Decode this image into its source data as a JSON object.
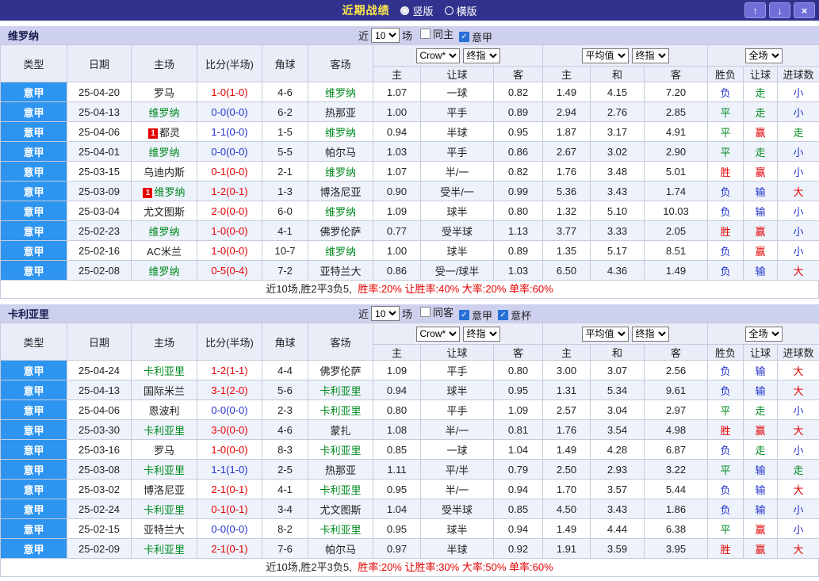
{
  "title_bar": {
    "title": "近期战绩",
    "radios": [
      {
        "label": "竖版",
        "selected": true
      },
      {
        "label": "横版",
        "selected": false
      }
    ],
    "up_button": "↑",
    "down_button": "↓",
    "close_button": "×"
  },
  "filter_labels": {
    "near": "近",
    "games": "场"
  },
  "table_header": {
    "static_cols": [
      "类型",
      "日期",
      "主场",
      "比分(半场)",
      "角球",
      "客场"
    ],
    "group1": {
      "selects": [
        "Crow*",
        "终指"
      ],
      "subcols": [
        "主",
        "让球",
        "客"
      ]
    },
    "group2": {
      "selects": [
        "平均值",
        "终指"
      ],
      "subcols": [
        "主",
        "和",
        "客"
      ]
    },
    "group3": {
      "selects": [
        "全场"
      ],
      "subcols": [
        "胜负",
        "让球",
        "进球数"
      ]
    }
  },
  "result_colors": {
    "胜": "red",
    "平": "green",
    "负": "blue",
    "赢": "red",
    "输": "blue",
    "走": "green",
    "大": "red",
    "小": "blue"
  },
  "sections": [
    {
      "team": "维罗纳",
      "filter": {
        "count": "10",
        "checkboxes": [
          {
            "label": "同主",
            "checked": false
          },
          {
            "label": "意甲",
            "checked": true
          }
        ]
      },
      "rows": [
        {
          "league": "意甲",
          "date": "25-04-20",
          "home": "罗马",
          "home_mark": "",
          "home_focus": false,
          "score": "1-0(1-0)",
          "score_color": "red",
          "corner": "4-6",
          "away": "维罗纳",
          "away_mark": "",
          "away_focus": true,
          "ah": [
            "1.07",
            "一球",
            "0.82"
          ],
          "eu": [
            "1.49",
            "4.15",
            "7.20"
          ],
          "res": [
            "负",
            "走",
            "小"
          ]
        },
        {
          "league": "意甲",
          "date": "25-04-13",
          "home": "维罗纳",
          "home_mark": "",
          "home_focus": true,
          "score": "0-0(0-0)",
          "score_color": "blue",
          "corner": "6-2",
          "away": "热那亚",
          "away_mark": "",
          "away_focus": false,
          "ah": [
            "1.00",
            "平手",
            "0.89"
          ],
          "eu": [
            "2.94",
            "2.76",
            "2.85"
          ],
          "res": [
            "平",
            "走",
            "小"
          ]
        },
        {
          "league": "意甲",
          "date": "25-04-06",
          "home": "都灵",
          "home_mark": "1",
          "home_focus": false,
          "score": "1-1(0-0)",
          "score_color": "blue",
          "corner": "1-5",
          "away": "维罗纳",
          "away_mark": "",
          "away_focus": true,
          "ah": [
            "0.94",
            "半球",
            "0.95"
          ],
          "eu": [
            "1.87",
            "3.17",
            "4.91"
          ],
          "res": [
            "平",
            "赢",
            "走"
          ]
        },
        {
          "league": "意甲",
          "date": "25-04-01",
          "home": "维罗纳",
          "home_mark": "",
          "home_focus": true,
          "score": "0-0(0-0)",
          "score_color": "blue",
          "corner": "5-5",
          "away": "帕尔马",
          "away_mark": "",
          "away_focus": false,
          "ah": [
            "1.03",
            "平手",
            "0.86"
          ],
          "eu": [
            "2.67",
            "3.02",
            "2.90"
          ],
          "res": [
            "平",
            "走",
            "小"
          ]
        },
        {
          "league": "意甲",
          "date": "25-03-15",
          "home": "乌迪内斯",
          "home_mark": "",
          "home_focus": false,
          "score": "0-1(0-0)",
          "score_color": "red",
          "corner": "2-1",
          "away": "维罗纳",
          "away_mark": "",
          "away_focus": true,
          "ah": [
            "1.07",
            "半/一",
            "0.82"
          ],
          "eu": [
            "1.76",
            "3.48",
            "5.01"
          ],
          "res": [
            "胜",
            "赢",
            "小"
          ]
        },
        {
          "league": "意甲",
          "date": "25-03-09",
          "home": "维罗纳",
          "home_mark": "1",
          "home_focus": true,
          "score": "1-2(0-1)",
          "score_color": "red",
          "corner": "1-3",
          "away": "博洛尼亚",
          "away_mark": "",
          "away_focus": false,
          "ah": [
            "0.90",
            "受半/一",
            "0.99"
          ],
          "eu": [
            "5.36",
            "3.43",
            "1.74"
          ],
          "res": [
            "负",
            "输",
            "大"
          ]
        },
        {
          "league": "意甲",
          "date": "25-03-04",
          "home": "尤文图斯",
          "home_mark": "",
          "home_focus": false,
          "score": "2-0(0-0)",
          "score_color": "red",
          "corner": "6-0",
          "away": "维罗纳",
          "away_mark": "",
          "away_focus": true,
          "ah": [
            "1.09",
            "球半",
            "0.80"
          ],
          "eu": [
            "1.32",
            "5.10",
            "10.03"
          ],
          "res": [
            "负",
            "输",
            "小"
          ]
        },
        {
          "league": "意甲",
          "date": "25-02-23",
          "home": "维罗纳",
          "home_mark": "",
          "home_focus": true,
          "score": "1-0(0-0)",
          "score_color": "red",
          "corner": "4-1",
          "away": "佛罗伦萨",
          "away_mark": "",
          "away_focus": false,
          "ah": [
            "0.77",
            "受半球",
            "1.13"
          ],
          "eu": [
            "3.77",
            "3.33",
            "2.05"
          ],
          "res": [
            "胜",
            "赢",
            "小"
          ]
        },
        {
          "league": "意甲",
          "date": "25-02-16",
          "home": "AC米兰",
          "home_mark": "",
          "home_focus": false,
          "score": "1-0(0-0)",
          "score_color": "red",
          "corner": "10-7",
          "away": "维罗纳",
          "away_mark": "",
          "away_focus": true,
          "ah": [
            "1.00",
            "球半",
            "0.89"
          ],
          "eu": [
            "1.35",
            "5.17",
            "8.51"
          ],
          "res": [
            "负",
            "赢",
            "小"
          ]
        },
        {
          "league": "意甲",
          "date": "25-02-08",
          "home": "维罗纳",
          "home_mark": "",
          "home_focus": true,
          "score": "0-5(0-4)",
          "score_color": "red",
          "corner": "7-2",
          "away": "亚特兰大",
          "away_mark": "",
          "away_focus": false,
          "ah": [
            "0.86",
            "受一/球半",
            "1.03"
          ],
          "eu": [
            "6.50",
            "4.36",
            "1.49"
          ],
          "res": [
            "负",
            "输",
            "大"
          ]
        }
      ],
      "summary": {
        "prefix": "近10场,胜2平3负5,",
        "stats": "胜率:20% 让胜率:40% 大率:20% 单率:60%"
      }
    },
    {
      "team": "卡利亚里",
      "filter": {
        "count": "10",
        "checkboxes": [
          {
            "label": "同客",
            "checked": false
          },
          {
            "label": "意甲",
            "checked": true
          },
          {
            "label": "意杯",
            "checked": true
          }
        ]
      },
      "rows": [
        {
          "league": "意甲",
          "date": "25-04-24",
          "home": "卡利亚里",
          "home_mark": "",
          "home_focus": true,
          "score": "1-2(1-1)",
          "score_color": "red",
          "corner": "4-4",
          "away": "佛罗伦萨",
          "away_mark": "",
          "away_focus": false,
          "ah": [
            "1.09",
            "平手",
            "0.80"
          ],
          "eu": [
            "3.00",
            "3.07",
            "2.56"
          ],
          "res": [
            "负",
            "输",
            "大"
          ]
        },
        {
          "league": "意甲",
          "date": "25-04-13",
          "home": "国际米兰",
          "home_mark": "",
          "home_focus": false,
          "score": "3-1(2-0)",
          "score_color": "red",
          "corner": "5-6",
          "away": "卡利亚里",
          "away_mark": "",
          "away_focus": true,
          "ah": [
            "0.94",
            "球半",
            "0.95"
          ],
          "eu": [
            "1.31",
            "5.34",
            "9.61"
          ],
          "res": [
            "负",
            "输",
            "大"
          ]
        },
        {
          "league": "意甲",
          "date": "25-04-06",
          "home": "恩波利",
          "home_mark": "",
          "home_focus": false,
          "score": "0-0(0-0)",
          "score_color": "blue",
          "corner": "2-3",
          "away": "卡利亚里",
          "away_mark": "",
          "away_focus": true,
          "ah": [
            "0.80",
            "平手",
            "1.09"
          ],
          "eu": [
            "2.57",
            "3.04",
            "2.97"
          ],
          "res": [
            "平",
            "走",
            "小"
          ]
        },
        {
          "league": "意甲",
          "date": "25-03-30",
          "home": "卡利亚里",
          "home_mark": "",
          "home_focus": true,
          "score": "3-0(0-0)",
          "score_color": "red",
          "corner": "4-6",
          "away": "蒙扎",
          "away_mark": "",
          "away_focus": false,
          "ah": [
            "1.08",
            "半/一",
            "0.81"
          ],
          "eu": [
            "1.76",
            "3.54",
            "4.98"
          ],
          "res": [
            "胜",
            "赢",
            "大"
          ]
        },
        {
          "league": "意甲",
          "date": "25-03-16",
          "home": "罗马",
          "home_mark": "",
          "home_focus": false,
          "score": "1-0(0-0)",
          "score_color": "red",
          "corner": "8-3",
          "away": "卡利亚里",
          "away_mark": "",
          "away_focus": true,
          "ah": [
            "0.85",
            "一球",
            "1.04"
          ],
          "eu": [
            "1.49",
            "4.28",
            "6.87"
          ],
          "res": [
            "负",
            "走",
            "小"
          ]
        },
        {
          "league": "意甲",
          "date": "25-03-08",
          "home": "卡利亚里",
          "home_mark": "",
          "home_focus": true,
          "score": "1-1(1-0)",
          "score_color": "blue",
          "corner": "2-5",
          "away": "热那亚",
          "away_mark": "",
          "away_focus": false,
          "ah": [
            "1.11",
            "平/半",
            "0.79"
          ],
          "eu": [
            "2.50",
            "2.93",
            "3.22"
          ],
          "res": [
            "平",
            "输",
            "走"
          ]
        },
        {
          "league": "意甲",
          "date": "25-03-02",
          "home": "博洛尼亚",
          "home_mark": "",
          "home_focus": false,
          "score": "2-1(0-1)",
          "score_color": "red",
          "corner": "4-1",
          "away": "卡利亚里",
          "away_mark": "",
          "away_focus": true,
          "ah": [
            "0.95",
            "半/一",
            "0.94"
          ],
          "eu": [
            "1.70",
            "3.57",
            "5.44"
          ],
          "res": [
            "负",
            "输",
            "大"
          ]
        },
        {
          "league": "意甲",
          "date": "25-02-24",
          "home": "卡利亚里",
          "home_mark": "",
          "home_focus": true,
          "score": "0-1(0-1)",
          "score_color": "red",
          "corner": "3-4",
          "away": "尤文图斯",
          "away_mark": "",
          "away_focus": false,
          "ah": [
            "1.04",
            "受半球",
            "0.85"
          ],
          "eu": [
            "4.50",
            "3.43",
            "1.86"
          ],
          "res": [
            "负",
            "输",
            "小"
          ]
        },
        {
          "league": "意甲",
          "date": "25-02-15",
          "home": "亚特兰大",
          "home_mark": "",
          "home_focus": false,
          "score": "0-0(0-0)",
          "score_color": "blue",
          "corner": "8-2",
          "away": "卡利亚里",
          "away_mark": "",
          "away_focus": true,
          "ah": [
            "0.95",
            "球半",
            "0.94"
          ],
          "eu": [
            "1.49",
            "4.44",
            "6.38"
          ],
          "res": [
            "平",
            "赢",
            "小"
          ]
        },
        {
          "league": "意甲",
          "date": "25-02-09",
          "home": "卡利亚里",
          "home_mark": "",
          "home_focus": true,
          "score": "2-1(0-1)",
          "score_color": "red",
          "corner": "7-6",
          "away": "帕尔马",
          "away_mark": "",
          "away_focus": false,
          "ah": [
            "0.97",
            "半球",
            "0.92"
          ],
          "eu": [
            "1.91",
            "3.59",
            "3.95"
          ],
          "res": [
            "胜",
            "赢",
            "大"
          ]
        }
      ],
      "summary": {
        "prefix": "近10场,胜2平3负5,",
        "stats": "胜率:20% 让胜率:30% 大率:50% 单率:60%"
      }
    }
  ]
}
